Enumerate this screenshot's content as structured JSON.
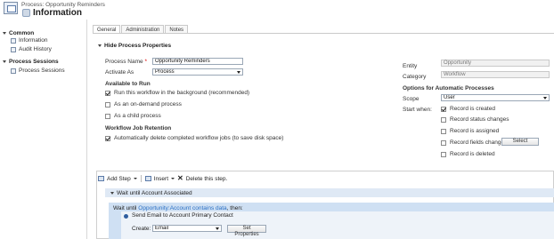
{
  "header": {
    "breadcrumb": "Process: Opportunity Reminders",
    "title": "Information"
  },
  "nav": {
    "common": {
      "heading": "Common",
      "items": [
        "Information",
        "Audit History"
      ]
    },
    "process_sessions": {
      "heading": "Process Sessions",
      "items": [
        "Process Sessions"
      ]
    }
  },
  "tabs": [
    "General",
    "Administration",
    "Notes"
  ],
  "hide_section": "Hide Process Properties",
  "process_name": {
    "label": "Process Name",
    "required": "*",
    "value": "Opportunity Reminders"
  },
  "activate_as": {
    "label": "Activate As",
    "value": "Process"
  },
  "available_to_run": {
    "heading": "Available to Run",
    "options": [
      {
        "label": "Run this workflow in the background (recommended)",
        "checked": true
      },
      {
        "label": "As an on-demand process",
        "checked": false
      },
      {
        "label": "As a child process",
        "checked": false
      }
    ]
  },
  "retention": {
    "heading": "Workflow Job Retention",
    "option": {
      "label": "Automatically delete completed workflow jobs (to save disk space)",
      "checked": true
    }
  },
  "entity": {
    "label": "Entity",
    "value": "Opportunity"
  },
  "category": {
    "label": "Category",
    "value": "Workflow"
  },
  "auto_options": {
    "heading": "Options for Automatic Processes",
    "scope": {
      "label": "Scope",
      "value": "User"
    },
    "start_when": {
      "label": "Start when:",
      "options": [
        {
          "label": "Record is created",
          "checked": true
        },
        {
          "label": "Record status changes",
          "checked": false
        },
        {
          "label": "Record is assigned",
          "checked": false
        },
        {
          "label": "Record fields change",
          "checked": false
        },
        {
          "label": "Record is deleted",
          "checked": false
        }
      ],
      "select_button": "Select"
    }
  },
  "toolbar": {
    "add_step": "Add Step",
    "insert": "Insert",
    "delete": "Delete this step."
  },
  "steps": {
    "step1": "Wait until Account Associated",
    "wait_prefix": "Wait until ",
    "wait_condition": "Opportunity:Account contains data",
    "wait_suffix": ", then:",
    "send_email": "Send Email to Account Primary Contact",
    "create_label": "Create:",
    "create_value": "Email",
    "set_properties": "Set Properties"
  }
}
